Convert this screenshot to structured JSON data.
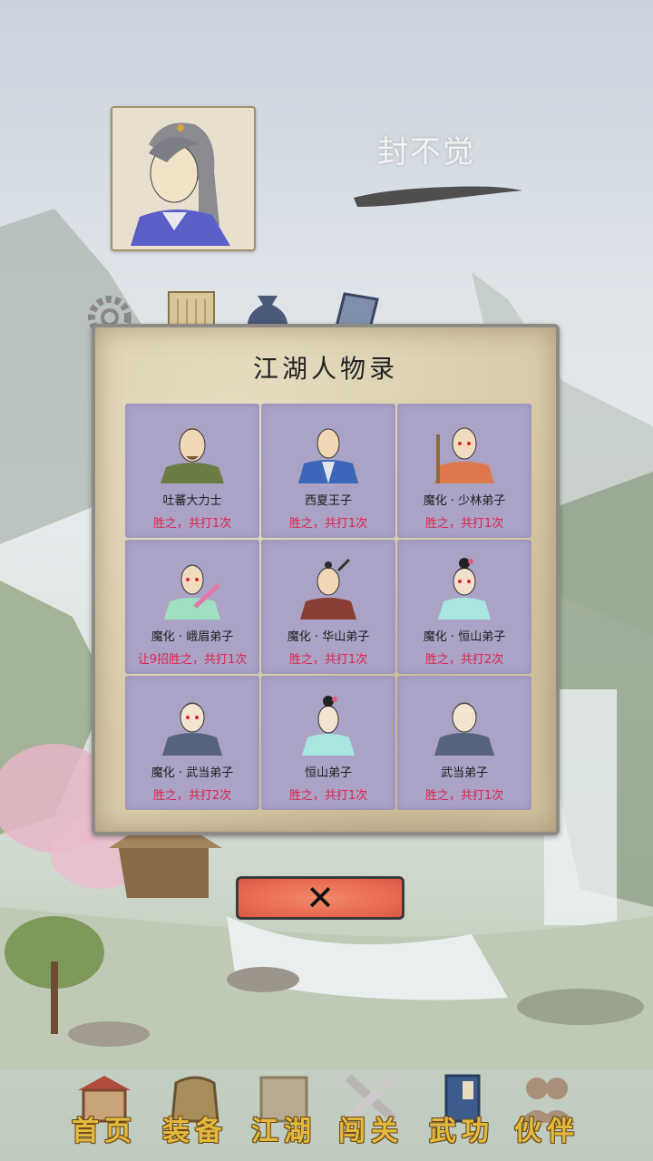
{
  "player": {
    "name": "封不觉"
  },
  "modal": {
    "title": "江湖人物录",
    "characters": [
      {
        "name": "吐蕃大力士",
        "record": "胜之，共打1次",
        "icon": "brown-haired-warrior"
      },
      {
        "name": "西夏王子",
        "record": "胜之，共打1次",
        "icon": "prince-blue-robe"
      },
      {
        "name": "魔化 · 少林弟子",
        "record": "胜之，共打1次",
        "icon": "bald-monk"
      },
      {
        "name": "魔化 · 峨眉弟子",
        "record": "让9招胜之，共打1次",
        "icon": "emei-disciple"
      },
      {
        "name": "魔化 · 华山弟子",
        "record": "胜之，共打1次",
        "icon": "huashan-swordsman"
      },
      {
        "name": "魔化 · 恒山弟子",
        "record": "胜之，共打2次",
        "icon": "hengshan-nun"
      },
      {
        "name": "魔化 · 武当弟子",
        "record": "胜之，共打2次",
        "icon": "wudang-disciple"
      },
      {
        "name": "恒山弟子",
        "record": "胜之，共打1次",
        "icon": "hengshan-girl"
      },
      {
        "name": "武当弟子",
        "record": "胜之，共打1次",
        "icon": "wudang-disciple"
      }
    ],
    "close_symbol": "✕"
  },
  "nav": [
    {
      "label": "首页",
      "icon": "house-icon"
    },
    {
      "label": "装备",
      "icon": "armor-icon"
    },
    {
      "label": "江湖",
      "icon": "scroll-map-icon"
    },
    {
      "label": "闯关",
      "icon": "crossed-swords-icon"
    },
    {
      "label": "武功",
      "icon": "book-icon"
    },
    {
      "label": "伙伴",
      "icon": "companions-icon"
    }
  ],
  "colors": {
    "record_red": "#e0214b",
    "nav_gold": "#e3b93d",
    "cell_purple": "#aaa3c6"
  }
}
